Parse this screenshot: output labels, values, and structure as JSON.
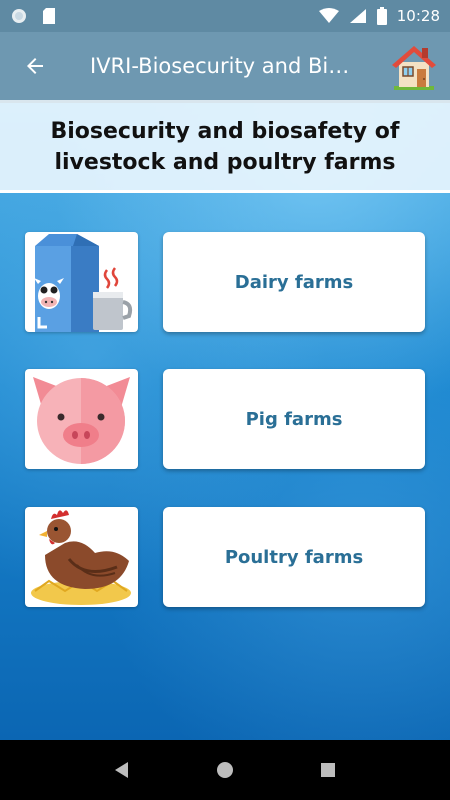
{
  "status_bar": {
    "time": "10:28",
    "icons": [
      "circle-notification-icon",
      "sd-card-icon",
      "wifi-icon",
      "signal-icon",
      "battery-icon"
    ]
  },
  "app_bar": {
    "title": "IVRI-Biosecurity and Bi…",
    "back_icon": "arrow-left-icon",
    "home_icon": "home-icon"
  },
  "page": {
    "heading": "Biosecurity and biosafety of livestock and poultry farms"
  },
  "items": [
    {
      "label": "Dairy farms",
      "icon": "milk-carton-cow-icon"
    },
    {
      "label": "Pig farms",
      "icon": "pig-face-icon"
    },
    {
      "label": "Poultry farms",
      "icon": "hen-icon"
    }
  ],
  "nav": {
    "back": "nav-back-icon",
    "home": "nav-home-icon",
    "recents": "nav-recents-icon"
  },
  "colors": {
    "status_bar": "#5f8aa3",
    "app_bar": "#6e98b1",
    "card_text": "#2a6f96",
    "background": "#1a86cf"
  }
}
